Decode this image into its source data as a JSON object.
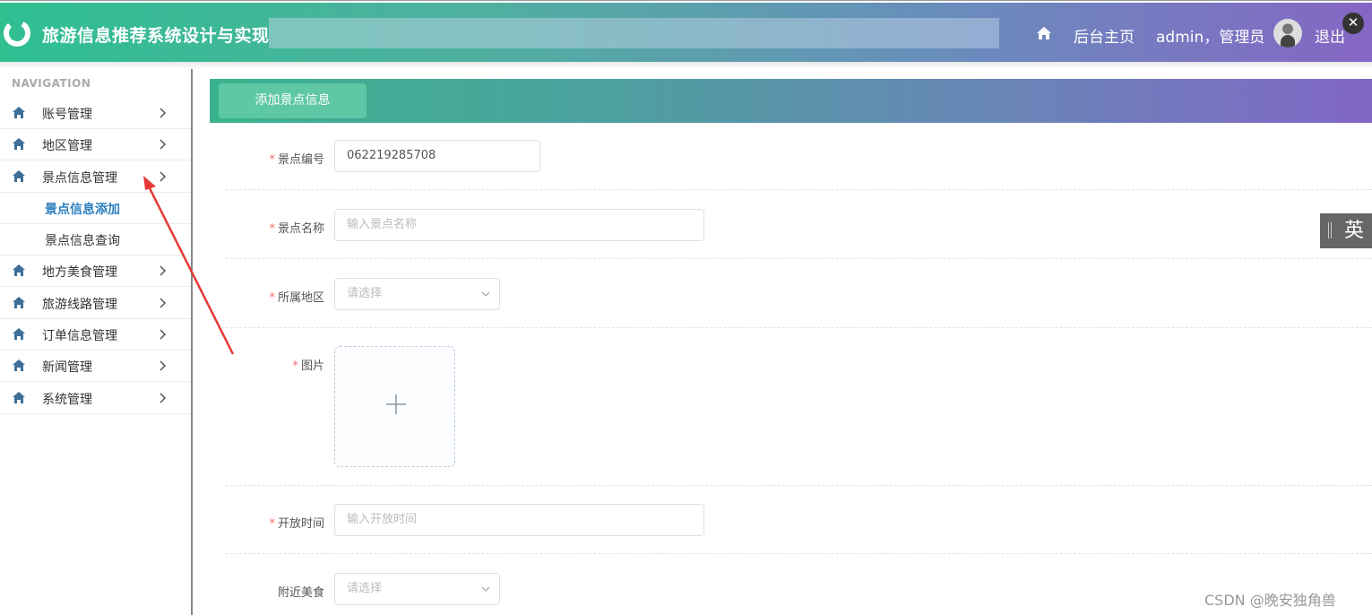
{
  "header": {
    "app_title": "旅游信息推荐系统设计与实现",
    "home_label": "后台主页",
    "user_label": "admin，管理员",
    "logout_label": "退出",
    "close_symbol": "✕"
  },
  "sidebar": {
    "heading": "NAVIGATION",
    "items": [
      {
        "label": "账号管理"
      },
      {
        "label": "地区管理"
      },
      {
        "label": "景点信息管理"
      },
      {
        "label": "地方美食管理"
      },
      {
        "label": "旅游线路管理"
      },
      {
        "label": "订单信息管理"
      },
      {
        "label": "新闻管理"
      },
      {
        "label": "系统管理"
      }
    ],
    "sub_items": [
      {
        "label": "景点信息添加",
        "active": true
      },
      {
        "label": "景点信息查询",
        "active": false
      }
    ]
  },
  "panel": {
    "tab_label": "添加景点信息"
  },
  "form": {
    "required_mark": "*",
    "spot_code": {
      "label": "景点编号",
      "value": "062219285708"
    },
    "spot_name": {
      "label": "景点名称",
      "placeholder": "输入景点名称"
    },
    "region": {
      "label": "所属地区",
      "placeholder": "请选择"
    },
    "image": {
      "label": "图片"
    },
    "open_time": {
      "label": "开放时间",
      "placeholder": "输入开放时间"
    },
    "nearby_food": {
      "label": "附近美食",
      "placeholder": "请选择"
    }
  },
  "ime": {
    "label": "英"
  },
  "watermark": "CSDN @晚安独角兽",
  "colors": {
    "accent_green": "#2fbf91",
    "accent_purple": "#8566c4",
    "required_red": "#f56c6c",
    "active_blue": "#2b7fbf"
  }
}
